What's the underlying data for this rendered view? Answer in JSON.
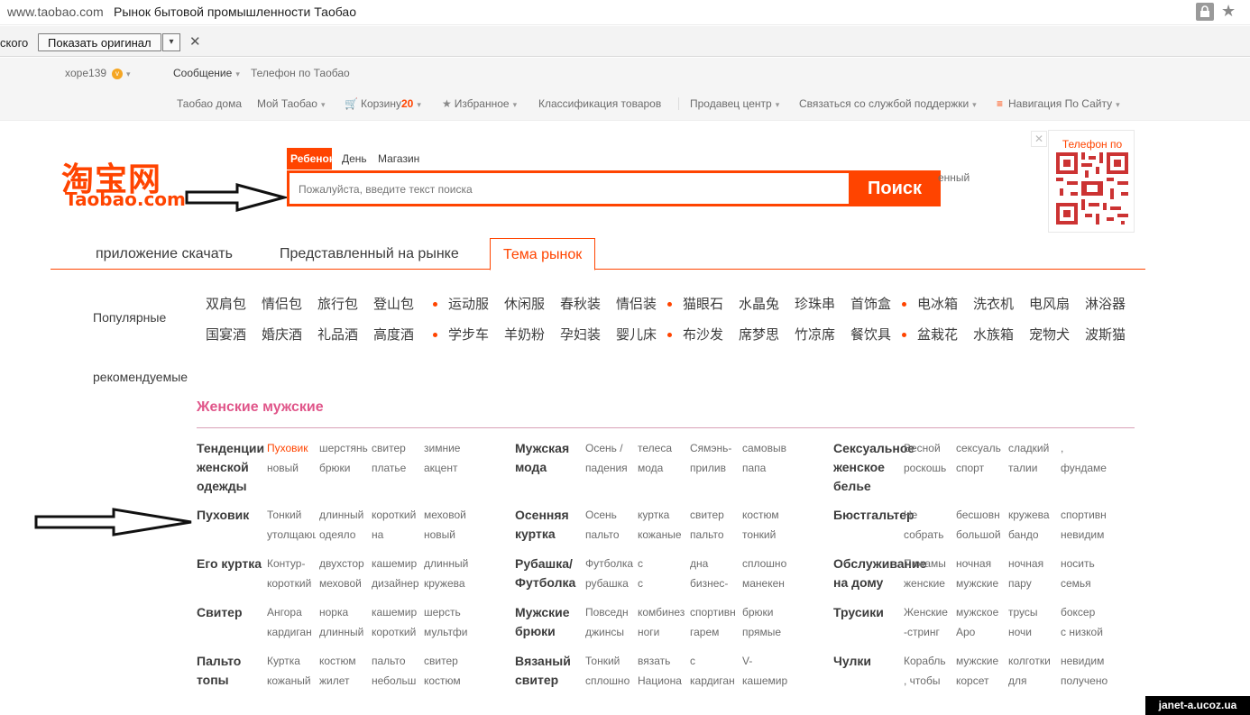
{
  "browser": {
    "url": "www.taobao.com",
    "title": "Рынок бытовой промышленности Таобао"
  },
  "translate_bar": {
    "language_fragment": "ского",
    "show_original_label": "Показать оригинал",
    "dropdown_glyph": "▾",
    "close_glyph": "✕"
  },
  "top_links": {
    "user": "xope139",
    "user_badge": "v",
    "message": "Сообщение",
    "phone": "Телефон по Таобао",
    "home": "Таобао дома",
    "my": "Мой Таобао",
    "cart_label": "Корзину",
    "cart_count": "20",
    "favorites": "Избранное",
    "classification": "Классификация товаров",
    "seller": "Продавец центр",
    "support": "Связаться со службой поддержки",
    "sitenav": "Навигация По Сайту"
  },
  "logo": {
    "cn": "淘宝网",
    "en": "Taobao.com"
  },
  "search": {
    "tabs": [
      "Ребенок",
      "День",
      "Магазин"
    ],
    "placeholder": "Пожалуйста, введите текст поиска",
    "button": "Поиск",
    "side_text": "енный"
  },
  "qr": {
    "title": "Телефон по",
    "close_glyph": "✕"
  },
  "main_tabs": [
    "приложение скачать",
    "Представленный на рынке",
    "Тема рынок"
  ],
  "hot": {
    "label_popular": "Популярные",
    "label_recommended": "рекомендуемые",
    "row1": [
      "双肩包",
      "情侣包",
      "旅行包",
      "登山包",
      "运动服",
      "休闲服",
      "春秋装",
      "情侣装",
      "猫眼石",
      "水晶兔",
      "珍珠串",
      "首饰盒",
      "电冰箱",
      "洗衣机",
      "电风扇",
      "淋浴器"
    ],
    "row2": [
      "国宴酒",
      "婚庆酒",
      "礼品酒",
      "高度酒",
      "学步车",
      "羊奶粉",
      "孕妇装",
      "婴儿床",
      "布沙发",
      "席梦思",
      "竹凉席",
      "餐饮具",
      "盆栽花",
      "水族箱",
      "宠物犬",
      "波斯猫"
    ]
  },
  "section": {
    "title": "Женские мужские",
    "columns": [
      {
        "rows": [
          {
            "cat": "Тенденции женской одежды",
            "items": [
              [
                "Пуховик",
                "новый"
              ],
              [
                "шерстяные",
                "брюки"
              ],
              [
                "свитер",
                "платье"
              ],
              [
                "зимние",
                "акцент"
              ]
            ],
            "highlight_first": true
          },
          {
            "cat": "Пуховик",
            "items": [
              [
                "Тонкий",
                "утолщающ"
              ],
              [
                "длинный",
                "одеяло"
              ],
              [
                "короткий",
                "на"
              ],
              [
                "меховой",
                "новый"
              ]
            ]
          },
          {
            "cat": "Его куртка",
            "items": [
              [
                "Контур-",
                "короткий"
              ],
              [
                "двухстор",
                "меховой"
              ],
              [
                "кашемир",
                "дизайнер"
              ],
              [
                "длинный",
                "кружева"
              ]
            ]
          },
          {
            "cat": "Свитер",
            "items": [
              [
                "Ангора",
                "кардиган"
              ],
              [
                "норка",
                "длинный"
              ],
              [
                "кашемир",
                "короткий"
              ],
              [
                "шерсть",
                "мультфи"
              ]
            ]
          },
          {
            "cat": "Пальто топы",
            "items": [
              [
                "Куртка",
                "кожаный"
              ],
              [
                "костюм",
                "жилет"
              ],
              [
                "пальто",
                "небольш"
              ],
              [
                "свитер",
                "костюм"
              ]
            ]
          }
        ]
      },
      {
        "rows": [
          {
            "cat": "Мужская мода",
            "items": [
              [
                "Осень /",
                "падения"
              ],
              [
                "телеса",
                "мода"
              ],
              [
                "Сямэнь-",
                "прилив"
              ],
              [
                "самовыв",
                "папа"
              ]
            ]
          },
          {
            "cat": "Осенняя куртка",
            "items": [
              [
                "Осень",
                "пальто"
              ],
              [
                "куртка",
                "кожаные"
              ],
              [
                "свитер",
                "пальто"
              ],
              [
                "костюм",
                "тонкий"
              ]
            ]
          },
          {
            "cat": "Рубашка/ Футболка",
            "items": [
              [
                "Футболка",
                "рубашка"
              ],
              [
                "с",
                "с"
              ],
              [
                "дна",
                "бизнес-"
              ],
              [
                "сплошно",
                "манекен"
              ]
            ]
          },
          {
            "cat": "Мужские брюки",
            "items": [
              [
                "Повседн",
                "джинсы"
              ],
              [
                "комбинез",
                "ноги"
              ],
              [
                "спортивн",
                "гарем"
              ],
              [
                "брюки",
                "прямые"
              ]
            ]
          },
          {
            "cat": "Вязаный свитер",
            "items": [
              [
                "Тонкий",
                "сплошно"
              ],
              [
                "вязать",
                "Национа"
              ],
              [
                "с",
                "кардиган"
              ],
              [
                "V-",
                "кашемир"
              ]
            ]
          }
        ]
      },
      {
        "rows": [
          {
            "cat": "Сексуальное женское белье",
            "items": [
              [
                "Весной",
                "роскошь"
              ],
              [
                "сексуаль",
                "спорт"
              ],
              [
                "сладкий",
                "талии"
              ],
              [
                ",",
                "фундаме"
              ]
            ]
          },
          {
            "cat": "Бюстгальтер",
            "items": [
              [
                "Не",
                "собрать"
              ],
              [
                "бесшовн",
                "большой"
              ],
              [
                "кружева",
                "бандо"
              ],
              [
                "спортивн",
                "невидим"
              ]
            ]
          },
          {
            "cat": "Обслуживание на дому",
            "items": [
              [
                "Пижамы",
                "женские"
              ],
              [
                "ночная",
                "мужские"
              ],
              [
                "ночная",
                "пару"
              ],
              [
                "носить",
                "семья"
              ]
            ]
          },
          {
            "cat": "Трусики",
            "items": [
              [
                "Женские",
                "-стринг"
              ],
              [
                "мужское",
                "Аро"
              ],
              [
                "трусы",
                "ночи"
              ],
              [
                "боксер",
                "с низкой"
              ]
            ]
          },
          {
            "cat": "Чулки",
            "items": [
              [
                "Корабль",
                ", чтобы"
              ],
              [
                "мужские",
                "корсет"
              ],
              [
                "колготки",
                "для"
              ],
              [
                "невидим",
                "получено"
              ]
            ]
          }
        ]
      }
    ]
  },
  "watermark": "janet-a.ucoz.ua"
}
